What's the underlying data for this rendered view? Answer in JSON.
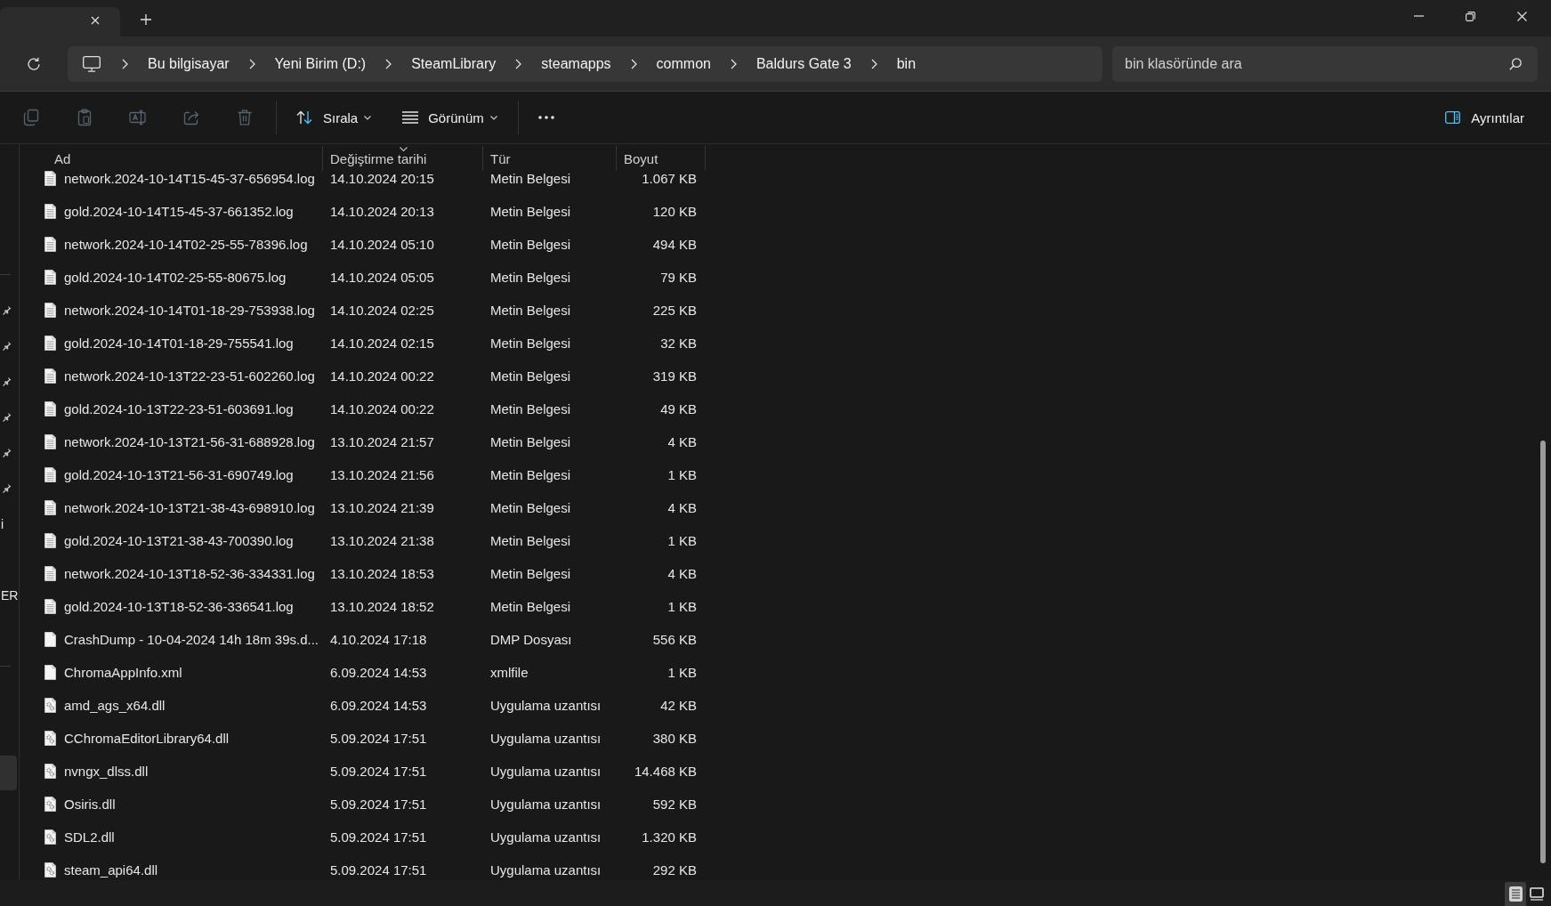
{
  "title_bar": {
    "tabs": [
      {
        "selected": true
      }
    ]
  },
  "address_bar": {
    "breadcrumb": [
      "Bu bilgisayar",
      "Yeni Birim (D:)",
      "SteamLibrary",
      "steamapps",
      "common",
      "Baldurs Gate 3",
      "bin"
    ]
  },
  "search": {
    "placeholder": "bin klasöründe ara"
  },
  "toolbar": {
    "actions": [
      {
        "kind": "copy",
        "disabled": true
      },
      {
        "kind": "paste",
        "disabled": true
      },
      {
        "kind": "rename",
        "disabled": true
      },
      {
        "kind": "share",
        "disabled": true
      },
      {
        "kind": "delete",
        "disabled": true
      }
    ],
    "menus": [
      {
        "kind": "sort",
        "label": "Sırala"
      },
      {
        "kind": "view",
        "label": "Görünüm"
      }
    ],
    "details_pane": {
      "label": "Ayrıntılar"
    }
  },
  "sidebar": {
    "items": [
      {
        "pinned": true,
        "selected": false
      },
      {
        "pinned": true,
        "selected": false
      },
      {
        "pinned": true,
        "selected": false
      },
      {
        "pinned": true,
        "selected": false
      },
      {
        "pinned": true,
        "selected": false
      },
      {
        "pinned": true,
        "selected": false
      },
      {
        "label": "i",
        "pinned": false,
        "selected": false
      },
      {
        "label": "ER",
        "pinned": false,
        "selected": false
      },
      {
        "pinned": false,
        "selected": true
      }
    ]
  },
  "file_list": {
    "columns": [
      {
        "label": "Ad",
        "sorted": false
      },
      {
        "label": "Değiştirme tarihi",
        "sorted": true
      },
      {
        "label": "Tür",
        "sorted": false
      },
      {
        "label": "Boyut",
        "sorted": false
      }
    ],
    "rows": [
      {
        "kind": "text",
        "name": "network.2024-10-14T15-45-37-656954.log",
        "modified": "14.10.2024 20:15",
        "type": "Metin Belgesi",
        "size": "1.067 KB"
      },
      {
        "kind": "text",
        "name": "gold.2024-10-14T15-45-37-661352.log",
        "modified": "14.10.2024 20:13",
        "type": "Metin Belgesi",
        "size": "120 KB"
      },
      {
        "kind": "text",
        "name": "network.2024-10-14T02-25-55-78396.log",
        "modified": "14.10.2024 05:10",
        "type": "Metin Belgesi",
        "size": "494 KB"
      },
      {
        "kind": "text",
        "name": "gold.2024-10-14T02-25-55-80675.log",
        "modified": "14.10.2024 05:05",
        "type": "Metin Belgesi",
        "size": "79 KB"
      },
      {
        "kind": "text",
        "name": "network.2024-10-14T01-18-29-753938.log",
        "modified": "14.10.2024 02:25",
        "type": "Metin Belgesi",
        "size": "225 KB"
      },
      {
        "kind": "text",
        "name": "gold.2024-10-14T01-18-29-755541.log",
        "modified": "14.10.2024 02:15",
        "type": "Metin Belgesi",
        "size": "32 KB"
      },
      {
        "kind": "text",
        "name": "network.2024-10-13T22-23-51-602260.log",
        "modified": "14.10.2024 00:22",
        "type": "Metin Belgesi",
        "size": "319 KB"
      },
      {
        "kind": "text",
        "name": "gold.2024-10-13T22-23-51-603691.log",
        "modified": "14.10.2024 00:22",
        "type": "Metin Belgesi",
        "size": "49 KB"
      },
      {
        "kind": "text",
        "name": "network.2024-10-13T21-56-31-688928.log",
        "modified": "13.10.2024 21:57",
        "type": "Metin Belgesi",
        "size": "4 KB"
      },
      {
        "kind": "text",
        "name": "gold.2024-10-13T21-56-31-690749.log",
        "modified": "13.10.2024 21:56",
        "type": "Metin Belgesi",
        "size": "1 KB"
      },
      {
        "kind": "text",
        "name": "network.2024-10-13T21-38-43-698910.log",
        "modified": "13.10.2024 21:39",
        "type": "Metin Belgesi",
        "size": "4 KB"
      },
      {
        "kind": "text",
        "name": "gold.2024-10-13T21-38-43-700390.log",
        "modified": "13.10.2024 21:38",
        "type": "Metin Belgesi",
        "size": "1 KB"
      },
      {
        "kind": "text",
        "name": "network.2024-10-13T18-52-36-334331.log",
        "modified": "13.10.2024 18:53",
        "type": "Metin Belgesi",
        "size": "4 KB"
      },
      {
        "kind": "text",
        "name": "gold.2024-10-13T18-52-36-336541.log",
        "modified": "13.10.2024 18:52",
        "type": "Metin Belgesi",
        "size": "1 KB"
      },
      {
        "kind": "file",
        "name": "CrashDump - 10-04-2024 14h 18m 39s.d...",
        "modified": "4.10.2024 17:18",
        "type": "DMP Dosyası",
        "size": "556 KB"
      },
      {
        "kind": "file",
        "name": "ChromaAppInfo.xml",
        "modified": "6.09.2024 14:53",
        "type": "xmlfile",
        "size": "1 KB"
      },
      {
        "kind": "dll",
        "name": "amd_ags_x64.dll",
        "modified": "6.09.2024 14:53",
        "type": "Uygulama uzantısı",
        "size": "42 KB"
      },
      {
        "kind": "dll",
        "name": "CChromaEditorLibrary64.dll",
        "modified": "5.09.2024 17:51",
        "type": "Uygulama uzantısı",
        "size": "380 KB"
      },
      {
        "kind": "dll",
        "name": "nvngx_dlss.dll",
        "modified": "5.09.2024 17:51",
        "type": "Uygulama uzantısı",
        "size": "14.468 KB"
      },
      {
        "kind": "dll",
        "name": "Osiris.dll",
        "modified": "5.09.2024 17:51",
        "type": "Uygulama uzantısı",
        "size": "592 KB"
      },
      {
        "kind": "dll",
        "name": "SDL2.dll",
        "modified": "5.09.2024 17:51",
        "type": "Uygulama uzantısı",
        "size": "1.320 KB"
      },
      {
        "kind": "dll",
        "name": "steam_api64.dll",
        "modified": "5.09.2024 17:51",
        "type": "Uygulama uzantısı",
        "size": "292 KB"
      }
    ]
  },
  "status_bar": {
    "views": [
      {
        "kind": "details",
        "selected": true
      },
      {
        "kind": "tiles",
        "selected": false
      }
    ]
  }
}
